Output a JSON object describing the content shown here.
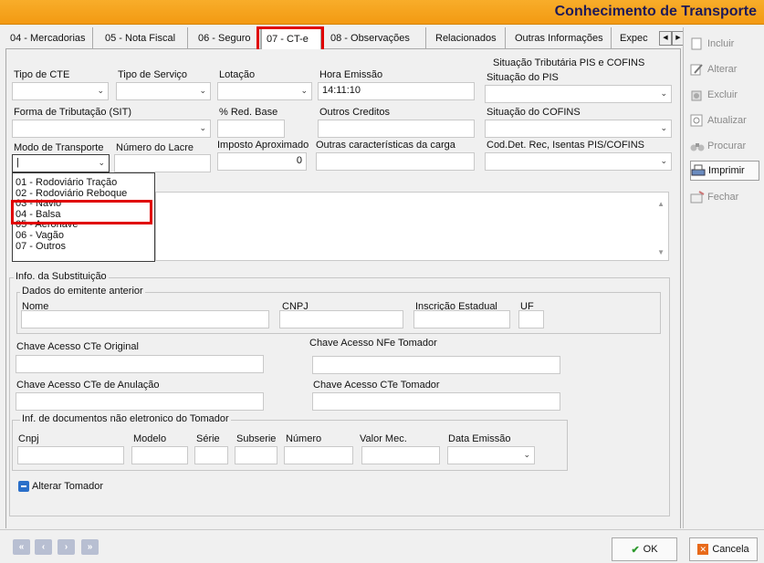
{
  "window": {
    "title": "Conhecimento de Transporte"
  },
  "tabs": [
    {
      "label": "04 - Mercadorias"
    },
    {
      "label": "05 - Nota Fiscal"
    },
    {
      "label": "06 - Seguro"
    },
    {
      "label": "07 - CT-e"
    },
    {
      "label": "08 - Observações"
    },
    {
      "label": "Relacionados"
    },
    {
      "label": "Outras Informações"
    },
    {
      "label": "Expec"
    }
  ],
  "tab_scroll": {
    "left": "◀",
    "right": "▶"
  },
  "form": {
    "tipo_cte": {
      "label": "Tipo de CTE",
      "value": ""
    },
    "tipo_servico": {
      "label": "Tipo de Serviço",
      "value": ""
    },
    "lotacao": {
      "label": "Lotação",
      "value": ""
    },
    "hora_emissao": {
      "label": "Hora Emissão",
      "value": "14:11:10"
    },
    "forma_tributacao": {
      "label": "Forma de Tributação (SIT)",
      "value": ""
    },
    "red_base": {
      "label": "% Red. Base",
      "value": ""
    },
    "outros_creditos": {
      "label": "Outros Creditos",
      "value": ""
    },
    "modo_transporte": {
      "label": "Modo de Transporte",
      "value": "|"
    },
    "numero_lacre": {
      "label": "Número do Lacre",
      "value": ""
    },
    "imposto_aproximado": {
      "label": "Imposto Aproximado",
      "value": "0"
    },
    "outras_caracteristicas": {
      "label": "Outras características da carga",
      "value": ""
    },
    "pis_cofins_group": "Situação Tributária PIS e COFINS",
    "situacao_pis": {
      "label": "Situação do PIS",
      "value": ""
    },
    "situacao_cofins": {
      "label": "Situação do COFINS",
      "value": ""
    },
    "cod_det": {
      "label": "Cod.Det. Rec, Isentas PIS/COFINS",
      "value": ""
    }
  },
  "transport_options": [
    "01 - Rodoviário Tração",
    "02 - Rodoviário Reboque",
    "03 - Navio",
    "04 - Balsa",
    "05 - Aeronave",
    "06 - Vagão",
    "07 - Outros"
  ],
  "substituicao": {
    "group": "Info. da Substituição",
    "emitente_group": "Dados do emitente anterior",
    "nome": "Nome",
    "cnpj": "CNPJ",
    "inscricao": "Inscrição Estadual",
    "uf": "UF",
    "chave_cte_original": "Chave Acesso CTe Original",
    "chave_nfe_tomador": "Chave Acesso NFe Tomador",
    "chave_cte_anulacao": "Chave Acesso CTe de Anulação",
    "chave_cte_tomador": "Chave Acesso CTe Tomador",
    "docs_group": "Inf. de documentos não eletronico do Tomador",
    "doc_cnpj": "Cnpj",
    "doc_modelo": "Modelo",
    "doc_serie": "Série",
    "doc_subserie": "Subserie",
    "doc_numero": "Número",
    "doc_valor": "Valor Mec.",
    "doc_data": "Data Emissão",
    "alterar_tomador": "Alterar Tomador"
  },
  "sidebar": {
    "incluir": "Incluir",
    "alterar": "Alterar",
    "excluir": "Excluir",
    "atualizar": "Atualizar",
    "procurar": "Procurar",
    "imprimir": "Imprimir",
    "fechar": "Fechar"
  },
  "footer": {
    "ok": "OK",
    "cancel": "Cancela"
  },
  "colors": {
    "title_bar": "#f39a12",
    "title_text": "#1e1a58",
    "highlight": "#e00000"
  }
}
